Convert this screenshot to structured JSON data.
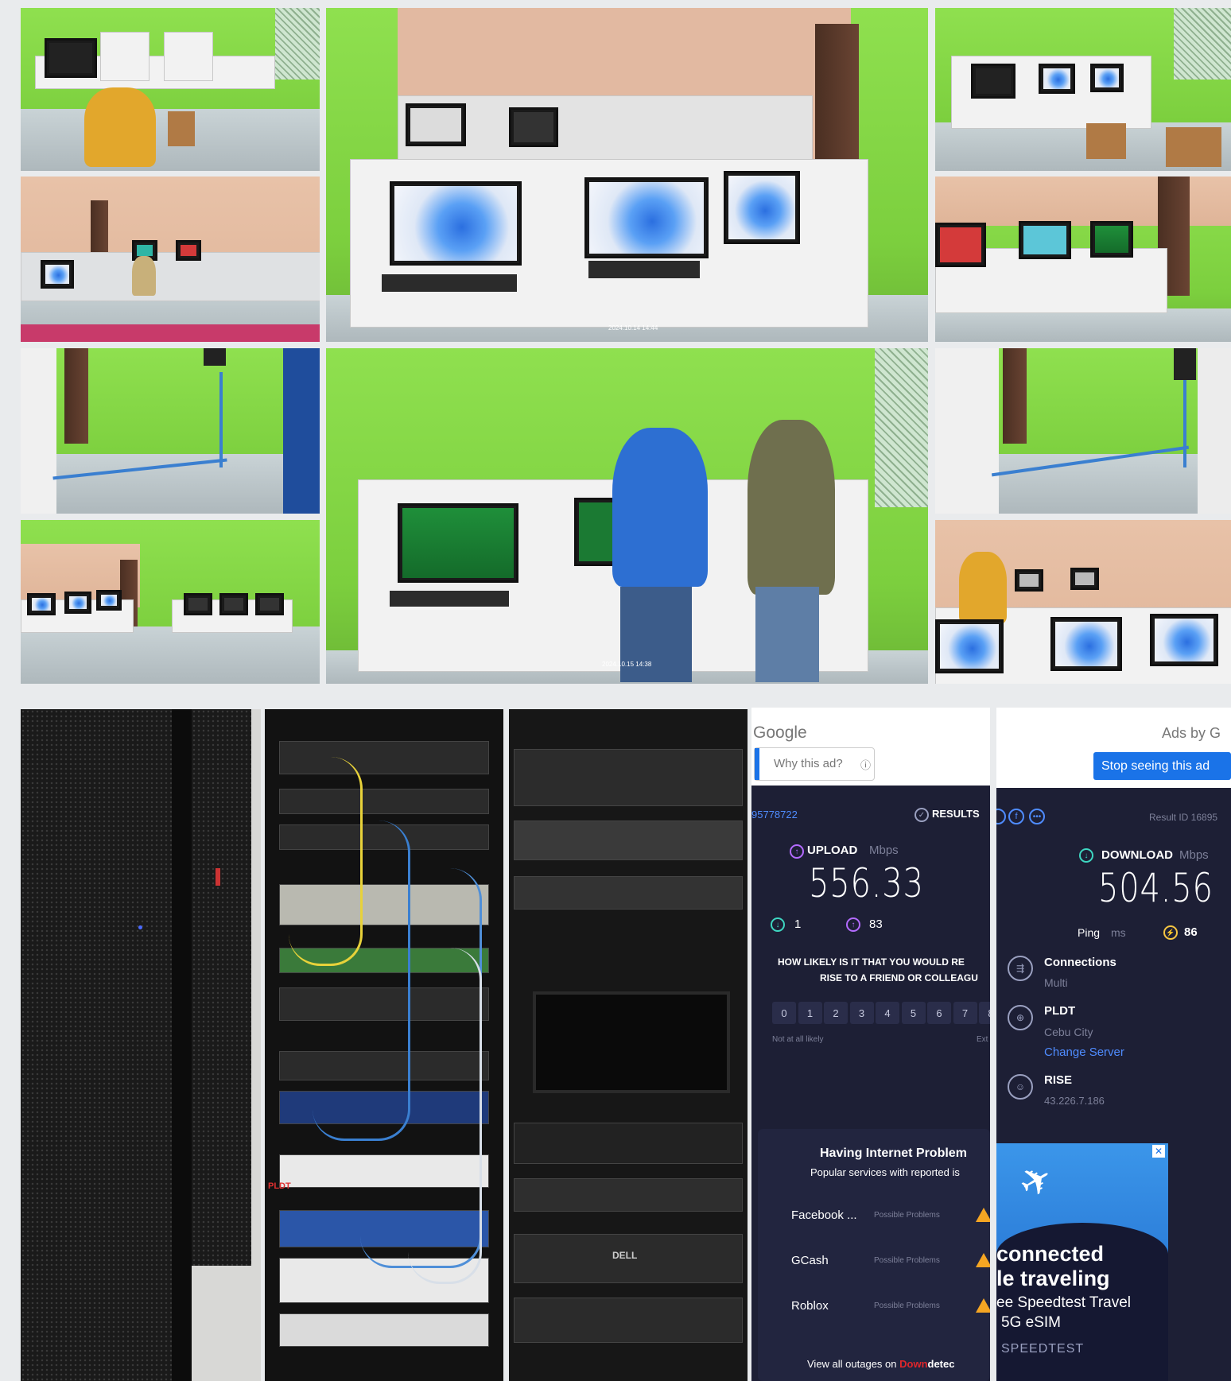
{
  "speedtest_left": {
    "ad_brand": "Google",
    "ad_question": "Why this ad?",
    "result_id_fragment": "95778722",
    "results_label": "RESULTS",
    "upload_label": "UPLOAD",
    "upload_unit": "Mbps",
    "upload_value": "556.33",
    "download_small": "1",
    "upload_small": "83",
    "survey_line1": "HOW LIKELY IS IT THAT YOU WOULD RE",
    "survey_line2": "RISE TO A FRIEND OR COLLEAGU",
    "scale": [
      "0",
      "1",
      "2",
      "3",
      "4",
      "5",
      "6",
      "7",
      "8"
    ],
    "scale_low": "Not at all likely",
    "scale_high": "Ext",
    "problems_title": "Having Internet Problem",
    "problems_subtitle": "Popular services with reported is",
    "services": [
      {
        "name": "Facebook ...",
        "status": "Possible Problems"
      },
      {
        "name": "GCash",
        "status": "Possible Problems"
      },
      {
        "name": "Roblox",
        "status": "Possible Problems"
      }
    ],
    "outages_prefix": "View all outages on ",
    "outages_brand_red": "Down",
    "outages_brand_rest": "detec"
  },
  "speedtest_right": {
    "ads_by": "Ads by G",
    "stop_ad": "Stop seeing this ad",
    "result_id": "Result ID 16895",
    "download_label": "DOWNLOAD",
    "download_unit": "Mbps",
    "download_value": "504.56",
    "ping_label": "Ping",
    "ping_unit": "ms",
    "ping_value": "86",
    "connections_label": "Connections",
    "connections_value": "Multi",
    "isp": "PLDT",
    "city": "Cebu City",
    "change_server": "Change Server",
    "host": "RISE",
    "ip": "43.226.7.186",
    "ad_line1": "connected",
    "ad_line2": "le traveling",
    "ad_line3": "ee Speedtest Travel",
    "ad_line4": "5G eSIM",
    "ad_brand": "SPEEDTEST"
  },
  "photo_stamps": {
    "center_top": "2024.10.14 14:44",
    "center_bottom": "2024.10.15 14:38"
  },
  "rack_labels": {
    "pldt": "PLDT",
    "dell": "DELL"
  },
  "colors": {
    "accent_green": "#7ccf3e",
    "speedtest_bg": "#1d1f35",
    "link_blue": "#4f8cff",
    "warning": "#f5a623",
    "downdetector_red": "#e0262b"
  }
}
